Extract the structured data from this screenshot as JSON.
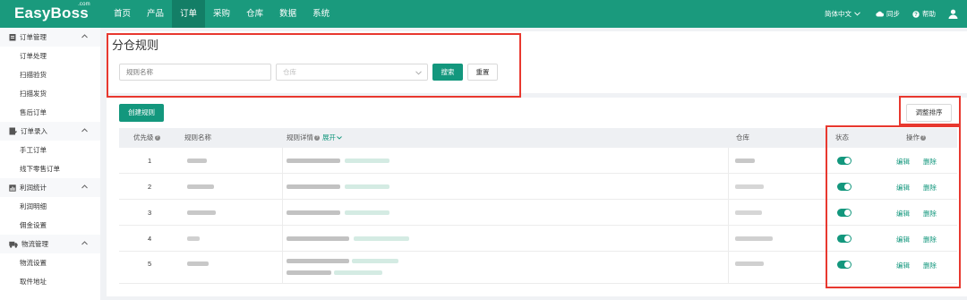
{
  "app": {
    "logo": "EasyBoss",
    "logo_suffix": ".com"
  },
  "nav": {
    "items": [
      "首页",
      "产品",
      "订单",
      "采购",
      "仓库",
      "数据",
      "系统"
    ],
    "active": "订单"
  },
  "topbar": {
    "language": "简体中文",
    "sync": "同步",
    "help": "帮助"
  },
  "sidebar": {
    "groups": [
      {
        "label": "订单管理",
        "items": [
          "订单处理",
          "扫描验货",
          "扫描发货",
          "售后订单"
        ]
      },
      {
        "label": "订单录入",
        "items": [
          "手工订单",
          "线下零售订单"
        ]
      },
      {
        "label": "利润统计",
        "items": [
          "利润明细",
          "佣金设置"
        ]
      },
      {
        "label": "物流管理",
        "items": [
          "物流设置",
          "取件地址"
        ]
      }
    ]
  },
  "page": {
    "title": "分仓规则"
  },
  "filters": {
    "rule_name_placeholder": "规则名称",
    "warehouse_placeholder": "仓库",
    "search_label": "搜索",
    "reset_label": "重置"
  },
  "actions": {
    "create_label": "创建规则",
    "sort_label": "调整排序"
  },
  "table": {
    "columns": {
      "priority": "优先级",
      "name": "规则名称",
      "detail": "规则详情",
      "expand": "展开",
      "warehouse": "仓库",
      "status": "状态",
      "operation": "操作"
    },
    "rows": [
      {
        "priority": "1",
        "enabled": true
      },
      {
        "priority": "2",
        "enabled": true
      },
      {
        "priority": "3",
        "enabled": true
      },
      {
        "priority": "4",
        "enabled": true
      },
      {
        "priority": "5",
        "enabled": true
      }
    ],
    "edit_label": "编辑",
    "delete_label": "删除"
  },
  "colors": {
    "brand": "#1a9a7d",
    "accent": "#13977d",
    "highlight_box": "#e8382f"
  }
}
